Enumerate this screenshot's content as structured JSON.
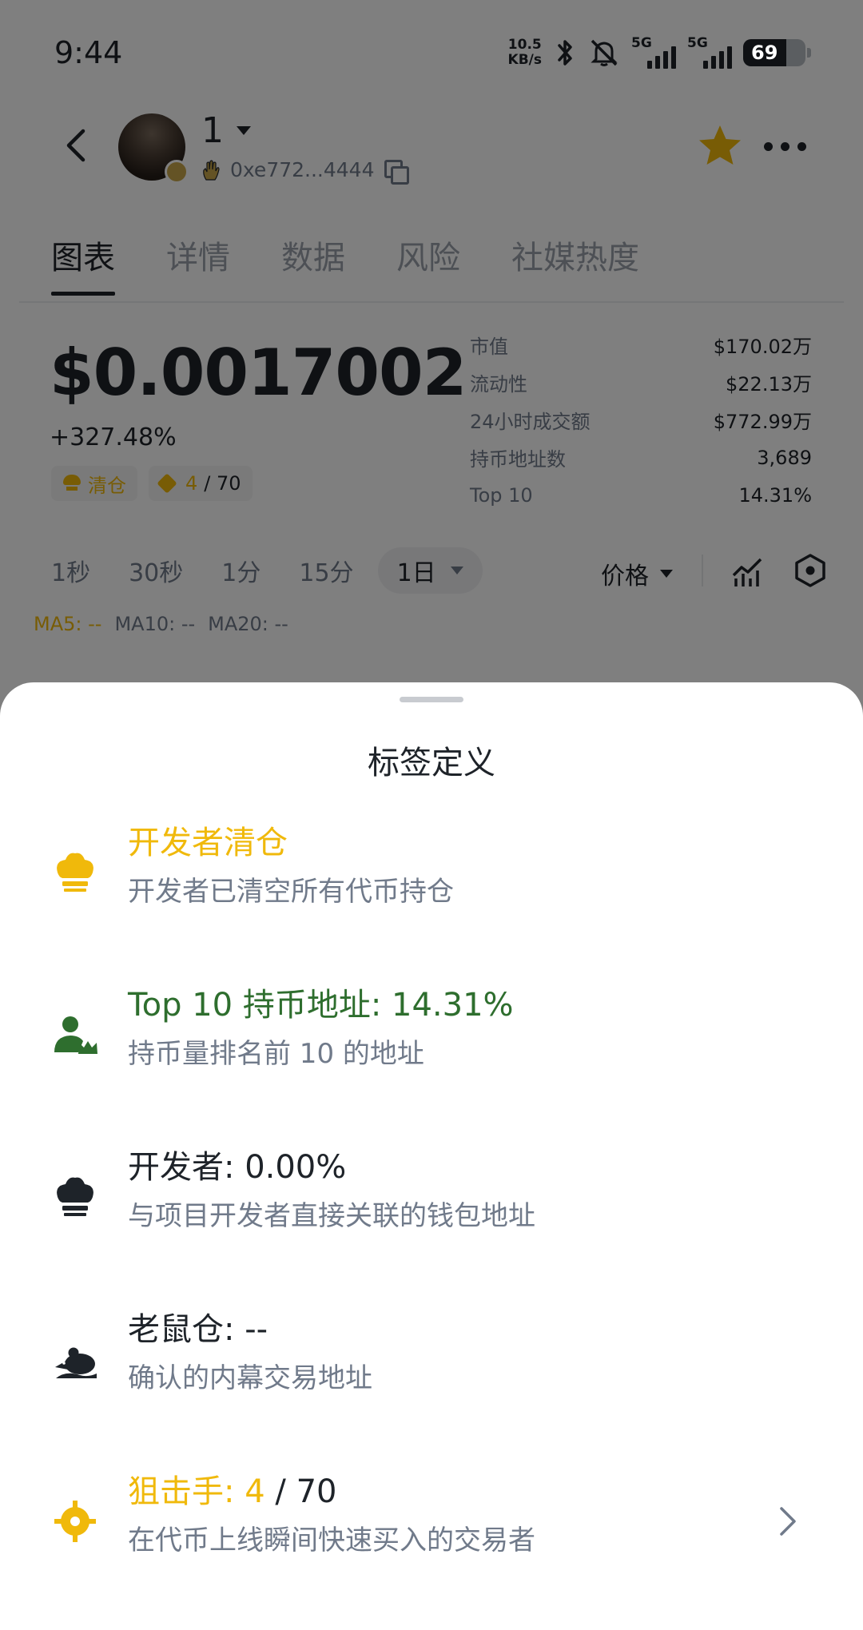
{
  "status_bar": {
    "time": "9:44",
    "net_speed_value": "10.5",
    "net_speed_unit": "KB/s",
    "signal_1": "5G",
    "signal_2": "5G",
    "battery": "69",
    "icons": [
      "bluetooth-icon",
      "mute-icon",
      "signal-icon",
      "battery-icon"
    ]
  },
  "header": {
    "token_name": "1",
    "address": "0xe772...4444",
    "icons": [
      "back-icon",
      "avatar",
      "hand-icon",
      "copy-icon",
      "star-icon",
      "more-icon"
    ]
  },
  "tabs": [
    {
      "label": "图表",
      "active": true
    },
    {
      "label": "详情",
      "active": false
    },
    {
      "label": "数据",
      "active": false
    },
    {
      "label": "风险",
      "active": false
    },
    {
      "label": "社媒热度",
      "active": false
    }
  ],
  "price": {
    "value": "$0.0017002",
    "change": "+327.48%",
    "tag_dev_clear": "清仓",
    "sniper_count": "4",
    "sniper_total": "/ 70"
  },
  "stats": [
    {
      "label": "市值",
      "value": "$170.02万"
    },
    {
      "label": "流动性",
      "value": "$22.13万"
    },
    {
      "label": "24小时成交额",
      "value": "$772.99万"
    },
    {
      "label": "持币地址数",
      "value": "3,689"
    },
    {
      "label": "Top 10",
      "value": "14.31%"
    }
  ],
  "intervals": [
    "1秒",
    "30秒",
    "1分",
    "15分"
  ],
  "interval_selected": "1日",
  "chart_toolbar": {
    "price_toggle": "价格",
    "icons": [
      "indicator-icon",
      "settings-hex-icon"
    ]
  },
  "ma": {
    "ma5": "MA5: --",
    "ma10": "MA10: --",
    "ma20": "MA20: --"
  },
  "sheet": {
    "title": "标签定义",
    "items": [
      {
        "title": "开发者清仓",
        "desc": "开发者已清空所有代币持仓",
        "icon": "chef-hat-icon"
      },
      {
        "title": "Top 10 持币地址: 14.31%",
        "desc": "持币量排名前 10 的地址",
        "icon": "user-crown-icon"
      },
      {
        "title": "开发者: 0.00%",
        "desc": "与项目开发者直接关联的钱包地址",
        "icon": "chef-hat-icon"
      },
      {
        "title": "老鼠仓: --",
        "desc": "确认的内幕交易地址",
        "icon": "rat-icon"
      },
      {
        "title_prefix": "狙击手: ",
        "title_count": "4",
        "title_suffix": " / 70",
        "desc": "在代币上线瞬间快速买入的交易者",
        "icon": "crosshair-icon"
      }
    ]
  },
  "colors": {
    "gold": "#f0b90b",
    "green": "#2e6e2e",
    "text_primary": "#1e2329",
    "text_secondary": "#707a8a"
  }
}
